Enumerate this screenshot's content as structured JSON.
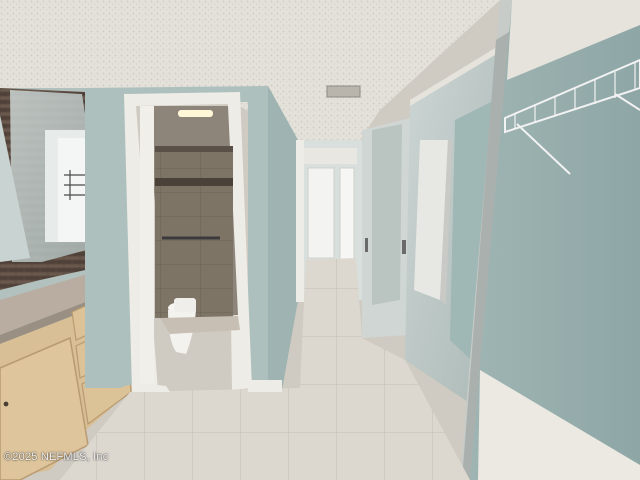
{
  "photo": {
    "watermark": "©2025 NEFMLS, Inc",
    "colors": {
      "ceiling": "#e4e1da",
      "wall": "#a9bcb8",
      "floor": "#ddd8cf",
      "trim": "#f2f0ea",
      "cabinet": "#d9bf95",
      "countertop": "#b8ada0",
      "shower_tile": "#7d7466"
    }
  }
}
